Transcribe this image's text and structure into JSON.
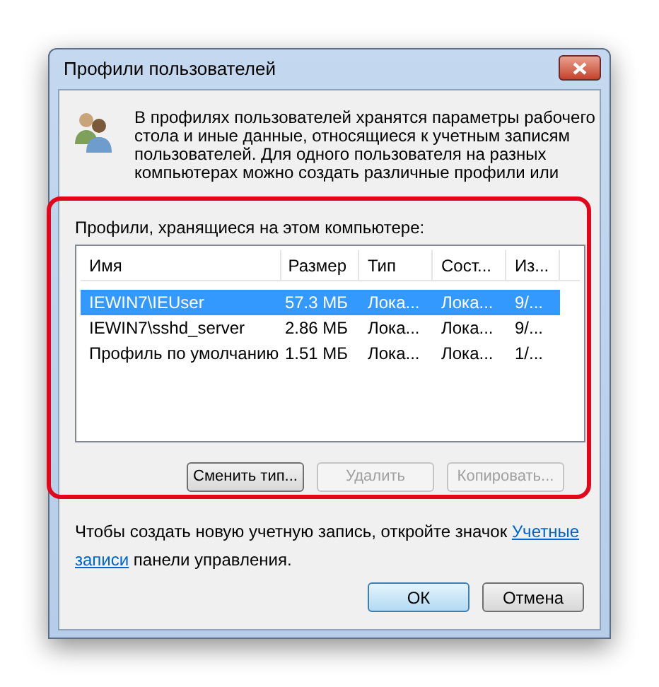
{
  "window": {
    "title": "Профили пользователей"
  },
  "intro_lines": [
    "В профилях пользователей хранятся параметры рабочего",
    "стола и иные данные, относящиеся к учетным записям",
    "пользователей. Для одного пользователя на разных",
    "компьютерах можно создать различные профили или"
  ],
  "group_label": "Профили, хранящиеся на этом компьютере:",
  "table": {
    "columns": [
      "Имя",
      "Размер",
      "Тип",
      "Сост...",
      "Из..."
    ],
    "rows": [
      {
        "selected": true,
        "cells": [
          "IEWIN7\\IEUser",
          "57.3 МБ",
          "Лока...",
          "Лока...",
          "9/..."
        ]
      },
      {
        "selected": false,
        "cells": [
          "IEWIN7\\sshd_server",
          "2.86 МБ",
          "Лока...",
          "Лока...",
          "9/..."
        ]
      },
      {
        "selected": false,
        "cells": [
          "Профиль по умолчанию",
          "1.51 МБ",
          "Лока...",
          "Лока...",
          "1/..."
        ]
      }
    ]
  },
  "profile_buttons": [
    {
      "label": "Сменить тип...",
      "disabled": false
    },
    {
      "label": "Удалить",
      "disabled": true
    },
    {
      "label": "Копировать...",
      "disabled": true
    }
  ],
  "footer": {
    "text_before": "Чтобы создать новую учетную запись, откройте значок",
    "link_parts": [
      "Учетные",
      "записи"
    ],
    "text_after": "панели управления."
  },
  "buttons": [
    {
      "label": "ОК",
      "default": true
    },
    {
      "label": "Отмена",
      "default": false
    }
  ]
}
